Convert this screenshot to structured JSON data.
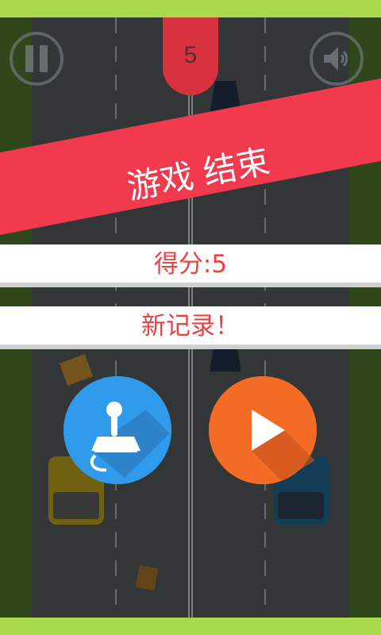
{
  "score_badge": "5",
  "game_over_title": "游戏 结束",
  "score_text": "得分:5",
  "record_text": "新记录！",
  "icons": {
    "pause": "pause-icon",
    "sound": "speaker-icon",
    "controller": "joystick-icon",
    "play": "play-icon"
  },
  "colors": {
    "grass_bright": "#a9d94f",
    "grass_dark": "#4a6f2a",
    "road": "#505556",
    "ribbon": "#f23a4f",
    "score_badge": "#d8323f",
    "button_blue": "#2f9bea",
    "button_orange": "#f36b24",
    "text_red": "#ea4245"
  }
}
